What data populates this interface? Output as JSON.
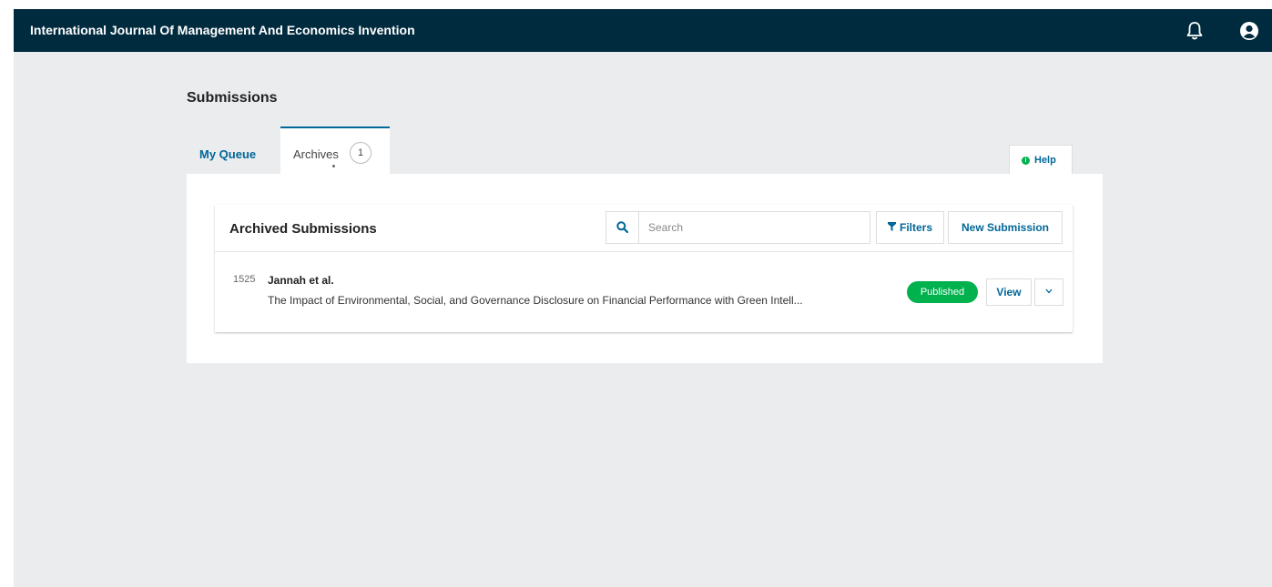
{
  "header": {
    "site_title": "International Journal Of Management And Economics Invention",
    "notifications_icon": "bell-icon",
    "user_icon": "user-circle-icon",
    "background": "#002b3f"
  },
  "page": {
    "title": "Submissions"
  },
  "tabs": [
    {
      "label": "My Queue",
      "active": false
    },
    {
      "label": "Archives",
      "count": "1",
      "active": true
    }
  ],
  "help": {
    "label": "Help",
    "icon": "info-icon"
  },
  "list": {
    "title": "Archived Submissions",
    "search": {
      "placeholder": "Search",
      "value": "",
      "icon": "search-icon"
    },
    "filters_label": "Filters",
    "filters_icon": "filter-icon",
    "new_submission_label": "New Submission",
    "items": [
      {
        "id": "1525",
        "authors": "Jannah et al.",
        "title": "The Impact of Environmental, Social, and Governance Disclosure on Financial Performance with Green Intell...",
        "status": "Published",
        "status_color": "#00b24e",
        "view_label": "View",
        "expand_icon": "chevron-down-icon"
      }
    ]
  },
  "colors": {
    "accent": "#006798",
    "page_background": "#eaecee"
  }
}
